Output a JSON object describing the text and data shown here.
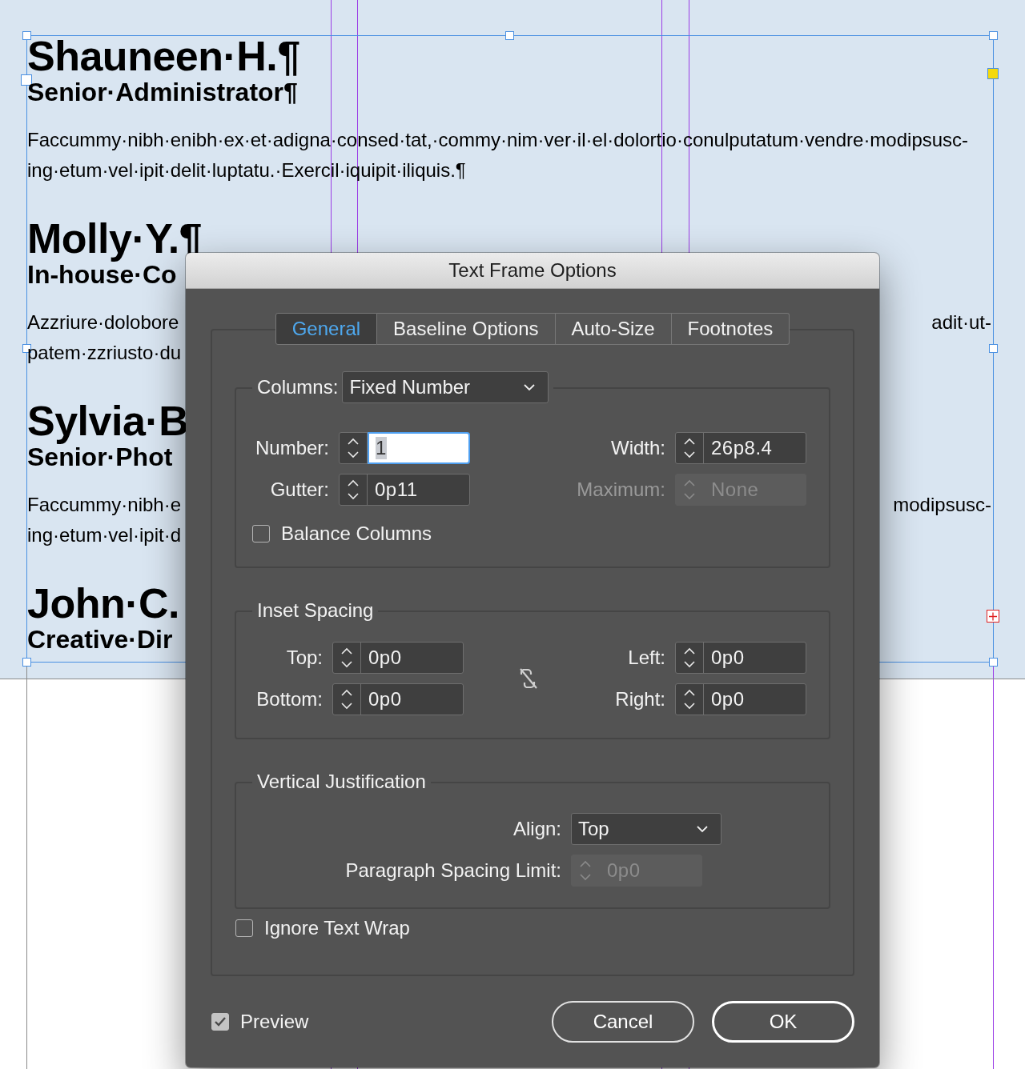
{
  "document": {
    "profiles": [
      {
        "name": "Shauneen·H.¶",
        "title": "Senior·Administrator¶",
        "body": [
          {
            "left": "Faccummy·nibh·enibh·ex·et·adigna·consed·tat,·commy·nim·ver·il·el·dolortio·conulputatum·vendre·modipsusc-"
          },
          {
            "left": "ing·etum·vel·ipit·delit·luptatu.·Exercil·iquipit·iliquis.¶"
          }
        ]
      },
      {
        "name": "Molly·Y.¶",
        "title": "In-house·Co",
        "body": [
          {
            "left": "Azzriure·dolobore",
            "right": "adit·ut-"
          },
          {
            "left": "patem·zzriusto·du"
          }
        ]
      },
      {
        "name": "Sylvia·B",
        "title": "Senior·Phot",
        "body": [
          {
            "left": "Faccummy·nibh·e",
            "right": "modipsusc-"
          },
          {
            "left": "ing·etum·vel·ipit·d"
          }
        ]
      },
      {
        "name": "John·C.",
        "title": "Creative·Dir"
      }
    ]
  },
  "dialog": {
    "title": "Text Frame Options",
    "tabs": [
      {
        "label": "General",
        "selected": true
      },
      {
        "label": "Baseline Options",
        "selected": false
      },
      {
        "label": "Auto-Size",
        "selected": false
      },
      {
        "label": "Footnotes",
        "selected": false
      }
    ],
    "columns": {
      "label": "Columns:",
      "mode": "Fixed Number",
      "fields": [
        {
          "label": "Number:",
          "value": "1",
          "focused": true,
          "disabled": false
        },
        {
          "label": "Width:",
          "value": "26p8.4",
          "focused": false,
          "disabled": false
        },
        {
          "label": "Gutter:",
          "value": "0p11",
          "focused": false,
          "disabled": false
        },
        {
          "label": "Maximum:",
          "value": "None",
          "focused": false,
          "disabled": true
        }
      ],
      "balance": {
        "label": "Balance Columns",
        "checked": false
      }
    },
    "inset": {
      "title": "Inset Spacing",
      "linked": false,
      "fields": [
        {
          "label": "Top:",
          "value": "0p0",
          "disabled": false
        },
        {
          "label": "Left:",
          "value": "0p0",
          "disabled": false
        },
        {
          "label": "Bottom:",
          "value": "0p0",
          "disabled": false
        },
        {
          "label": "Right:",
          "value": "0p0",
          "disabled": false
        }
      ]
    },
    "vertical": {
      "title": "Vertical Justification",
      "align": {
        "label": "Align:",
        "value": "Top"
      },
      "limit": {
        "label": "Paragraph Spacing Limit:",
        "value": "0p0",
        "disabled": true
      }
    },
    "ignore_wrap": {
      "label": "Ignore Text Wrap",
      "checked": false
    },
    "preview": {
      "label": "Preview",
      "checked": true
    },
    "buttons": [
      {
        "label": "Cancel",
        "default": false
      },
      {
        "label": "OK",
        "default": true
      }
    ]
  }
}
